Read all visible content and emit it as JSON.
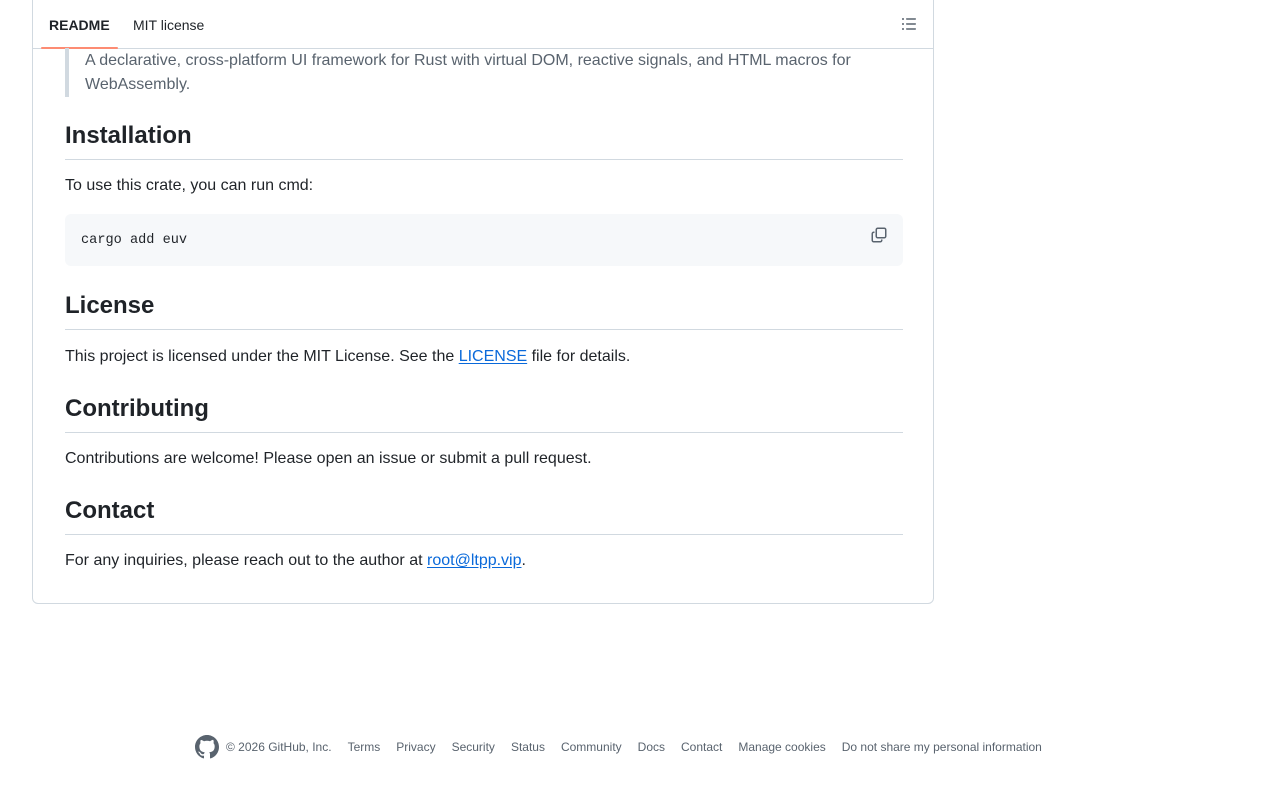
{
  "tabs": {
    "readme": "README",
    "license": "MIT license"
  },
  "outline_icon": "list-unordered-icon",
  "readme": {
    "blockquote": "A declarative, cross-platform UI framework for Rust with virtual DOM, reactive signals, and HTML macros for WebAssembly.",
    "installation": {
      "heading": "Installation",
      "intro": "To use this crate, you can run cmd:",
      "code": "cargo add euv",
      "copy_icon": "copy-icon"
    },
    "license": {
      "heading": "License",
      "text_before": "This project is licensed under the MIT License. See the ",
      "link": "LICENSE",
      "text_after": " file for details."
    },
    "contributing": {
      "heading": "Contributing",
      "text": "Contributions are welcome! Please open an issue or submit a pull request."
    },
    "contact": {
      "heading": "Contact",
      "text_before": "For any inquiries, please reach out to the author at ",
      "email": "root@ltpp.vip",
      "text_after": "."
    }
  },
  "footer": {
    "logo_icon": "github-mark-icon",
    "copyright": "© 2026 GitHub, Inc.",
    "links": [
      "Terms",
      "Privacy",
      "Security",
      "Status",
      "Community",
      "Docs",
      "Contact",
      "Manage cookies",
      "Do not share my personal information"
    ]
  },
  "colors": {
    "link": "#0969da",
    "tab_underline": "#fd8c73",
    "text": "#1f2328",
    "muted": "#59636e",
    "border": "#d1d9e0",
    "code_bg": "#f6f8fa"
  }
}
